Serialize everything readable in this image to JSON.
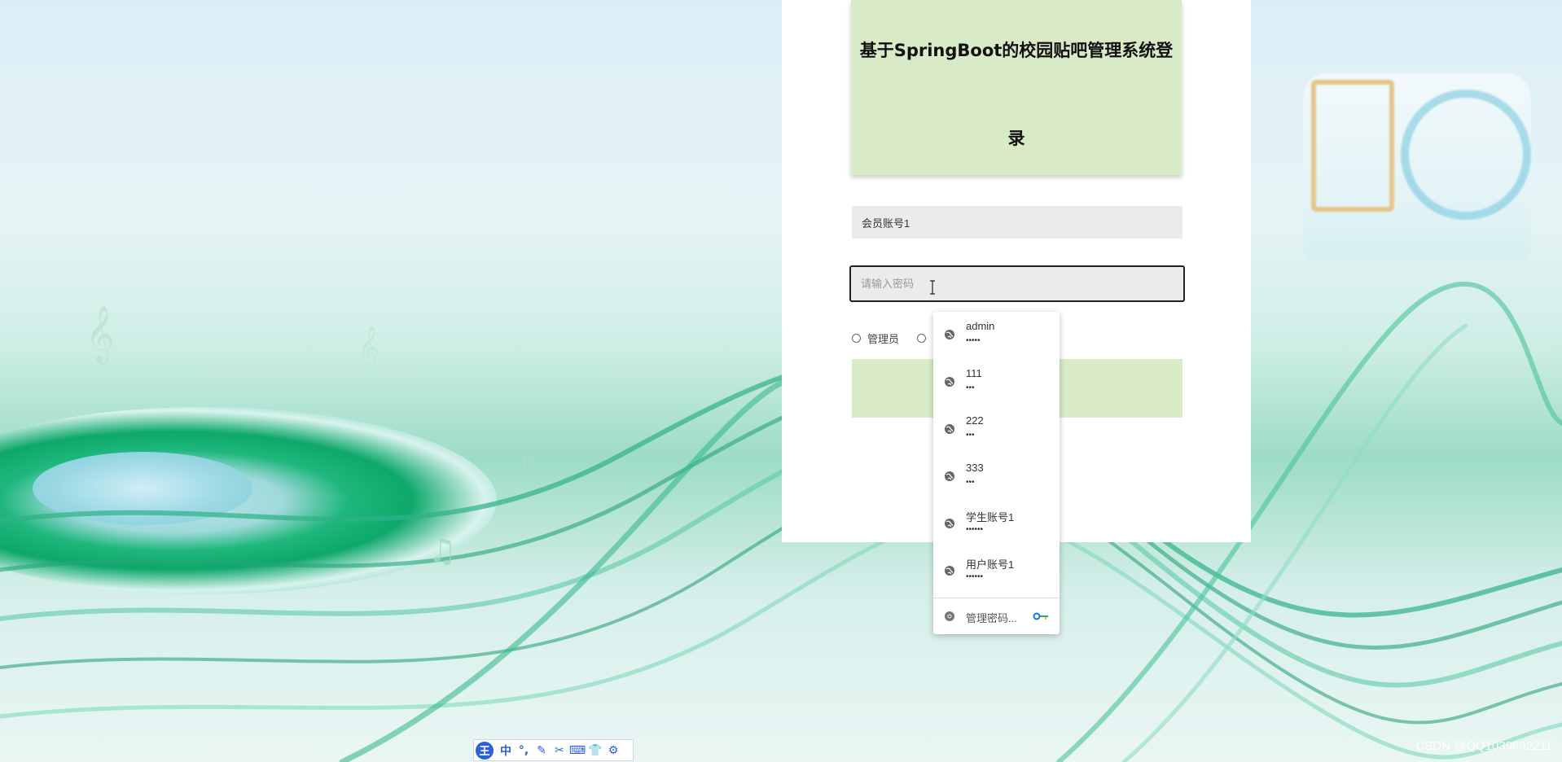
{
  "login": {
    "title": "基于SpringBoot的校园贴吧管理系统登录",
    "username_value": "会员账号1",
    "password_placeholder": "请输入密码",
    "role_label": "管理员"
  },
  "autofill": {
    "accounts": [
      {
        "name": "admin",
        "masked": "•••••"
      },
      {
        "name": "111",
        "masked": "•••"
      },
      {
        "name": "222",
        "masked": "•••"
      },
      {
        "name": "333",
        "masked": "•••"
      },
      {
        "name": "学生账号1",
        "masked": "••••••"
      },
      {
        "name": "用户账号1",
        "masked": "••••••"
      }
    ],
    "manage_label": "管理密码...",
    "icons": {
      "account": "globe-icon",
      "manage": "chrome-icon",
      "key": "key-icon"
    }
  },
  "ime_toolbar": {
    "logo": "王",
    "mode": "中",
    "icons": [
      "punctuation-icon",
      "pen-icon",
      "scissors-icon",
      "keyboard-icon",
      "shirt-icon",
      "gear-icon"
    ]
  },
  "watermark": "CSDN @QQ1039692211",
  "colors": {
    "accent_green": "#d8ebc6",
    "card": "#ffffff",
    "field": "#ebebeb"
  }
}
